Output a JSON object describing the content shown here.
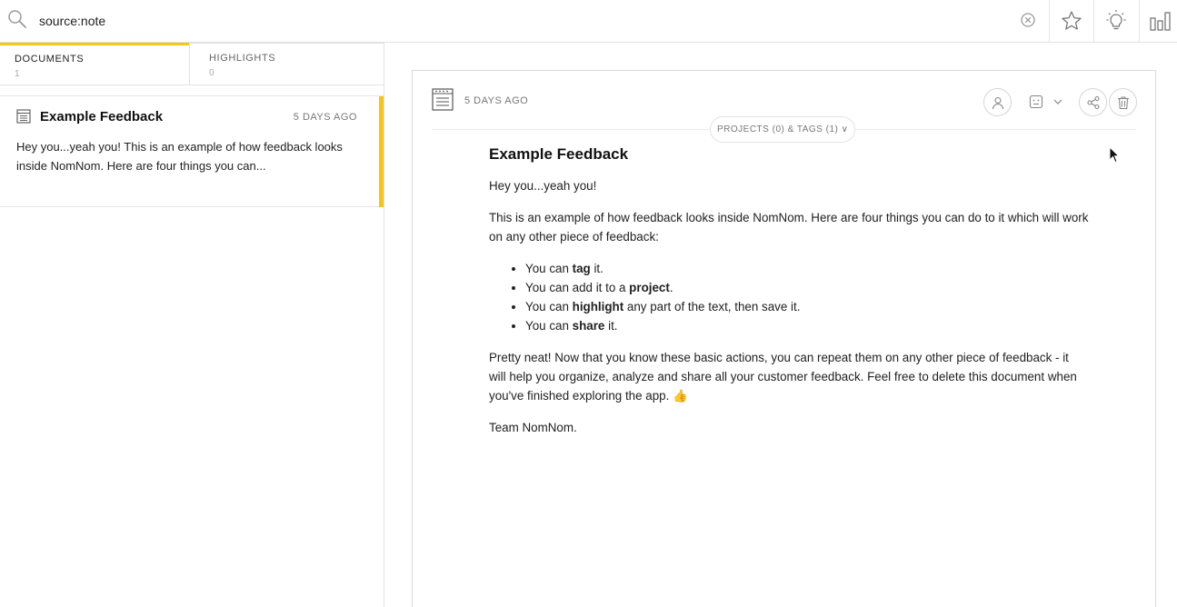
{
  "search": {
    "value": "source:note",
    "icons": {
      "search": "search-icon",
      "clear": "clear-circle-icon",
      "star": "star-icon",
      "lightbulb": "lightbulb-icon",
      "chart": "bar-chart-icon"
    }
  },
  "tabs": [
    {
      "label": "DOCUMENTS",
      "count": "1"
    },
    {
      "label": "HIGHLIGHTS",
      "count": "0"
    }
  ],
  "list": {
    "items": [
      {
        "title": "Example Feedback",
        "date": "5 DAYS AGO",
        "snippet": "Hey you...yeah you! This is an example of how feedback looks inside NomNom. Here are four things you can..."
      }
    ]
  },
  "document": {
    "date": "5 DAYS AGO",
    "tags_label": "PROJECTS (0) & TAGS (1) ∨",
    "title": "Example Feedback",
    "greeting": "Hey you...yeah you!",
    "intro": "This is an example of how feedback looks inside NomNom. Here are four things you can do to it which will work on any other piece of feedback:",
    "bullets": [
      {
        "pre": "You can ",
        "bold": "tag",
        "post": " it."
      },
      {
        "pre": "You can add it to a ",
        "bold": "project",
        "post": "."
      },
      {
        "pre": "You can ",
        "bold": "highlight",
        "post": " any part of the text, then save it."
      },
      {
        "pre": "You can ",
        "bold": "share",
        "post": " it."
      }
    ],
    "outro": "Pretty neat! Now that you know these basic actions, you can repeat them on any other piece of feedback - it will help you organize, analyze and share all your customer feedback. Feel free to delete this document when you've finished exploring the app. 👍",
    "signoff": "Team NomNom."
  },
  "colors": {
    "accent": "#f5c518",
    "border": "#e2e2e2",
    "muted": "#777777"
  }
}
